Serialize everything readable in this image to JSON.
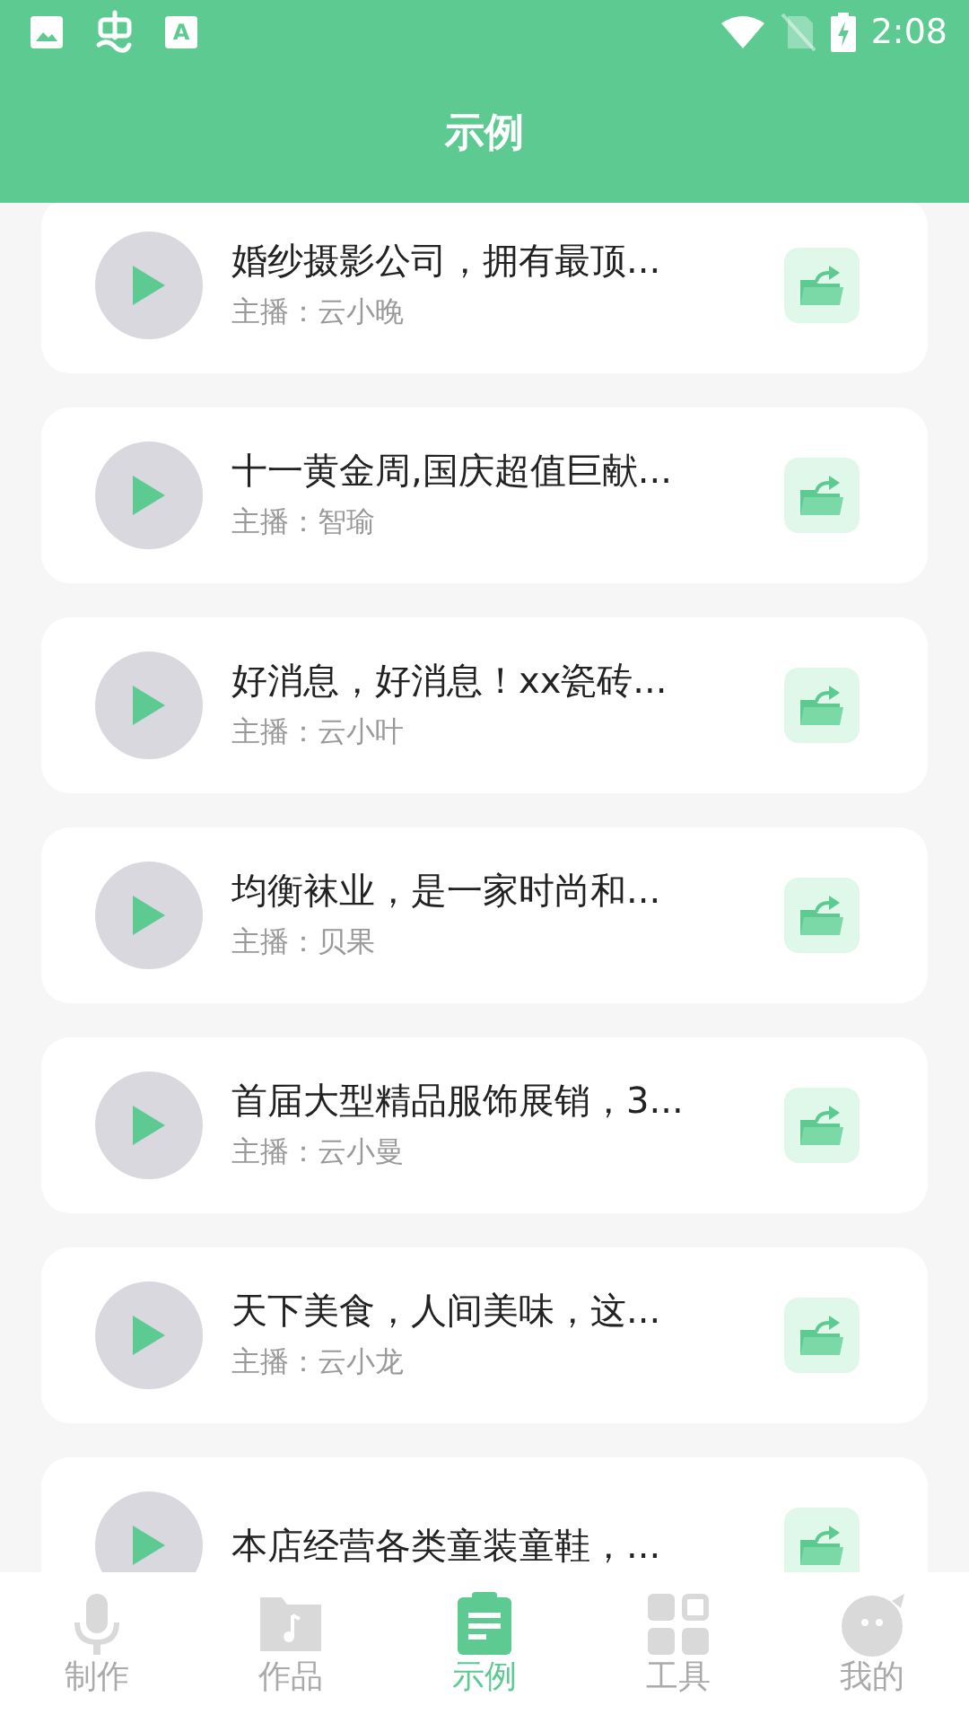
{
  "status_bar": {
    "badge_letter": "A",
    "time": "2:08"
  },
  "header": {
    "title": "示例"
  },
  "items": [
    {
      "title": "婚纱摄影公司，拥有最顶...",
      "host": "主播：云小晚"
    },
    {
      "title": "十一黄金周,国庆超值巨献...",
      "host": "主播：智瑜"
    },
    {
      "title": "好消息，好消息！xx瓷砖...",
      "host": "主播：云小叶"
    },
    {
      "title": "均衡袜业，是一家时尚和...",
      "host": "主播：贝果"
    },
    {
      "title": "首届大型精品服饰展销，3...",
      "host": "主播：云小曼"
    },
    {
      "title": "天下美食，人间美味，这...",
      "host": "主播：云小龙"
    },
    {
      "title": "本店经营各类童装童鞋，..."
    }
  ],
  "tabs": [
    {
      "kind": "mic",
      "label": "制作",
      "selected": false
    },
    {
      "kind": "folder",
      "label": "作品",
      "selected": false
    },
    {
      "kind": "clipboard",
      "label": "示例",
      "selected": true
    },
    {
      "kind": "grid",
      "label": "工具",
      "selected": false
    },
    {
      "kind": "face",
      "label": "我的",
      "selected": false
    }
  ]
}
